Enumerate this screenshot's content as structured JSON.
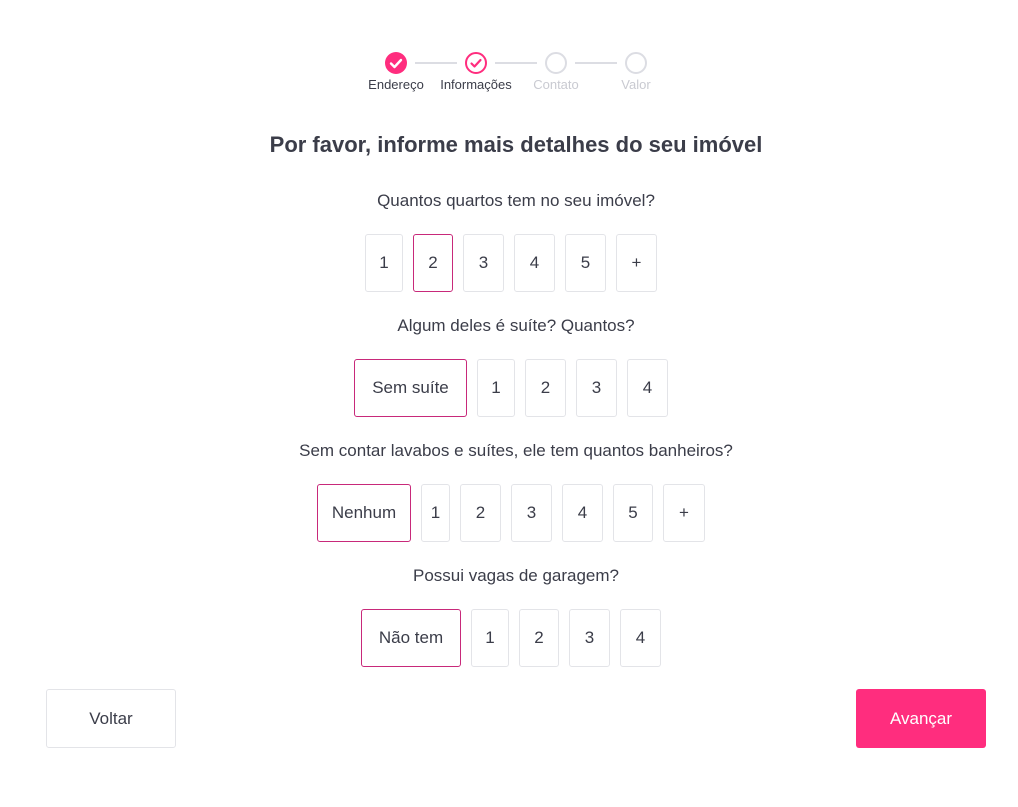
{
  "stepper": {
    "steps": [
      {
        "label": "Endereço",
        "state": "done"
      },
      {
        "label": "Informações",
        "state": "done"
      },
      {
        "label": "Contato",
        "state": "todo"
      },
      {
        "label": "Valor",
        "state": "todo"
      }
    ],
    "accent_color": "#ff2d7e",
    "inactive_color": "#dcdde3"
  },
  "title": "Por favor, informe mais detalhes do seu imóvel",
  "questions": [
    {
      "text": "Quantos quartos tem no seu imóvel?",
      "options": [
        "1",
        "2",
        "3",
        "4",
        "5",
        "+"
      ],
      "selected": "2"
    },
    {
      "text": "Algum deles é suíte? Quantos?",
      "options": [
        "Sem suíte",
        "1",
        "2",
        "3",
        "4"
      ],
      "selected": "Sem suíte"
    },
    {
      "text": "Sem contar lavabos e suítes, ele tem quantos banheiros?",
      "options": [
        "Nenhum",
        "1",
        "2",
        "3",
        "4",
        "5",
        "+"
      ],
      "selected": "Nenhum"
    },
    {
      "text": "Possui vagas de garagem?",
      "options": [
        "Não tem",
        "1",
        "2",
        "3",
        "4"
      ],
      "selected": "Não tem"
    }
  ],
  "buttons": {
    "back": "Voltar",
    "next": "Avançar"
  },
  "colors": {
    "primary": "#ff2d7e",
    "selected_border": "#c8297a"
  }
}
